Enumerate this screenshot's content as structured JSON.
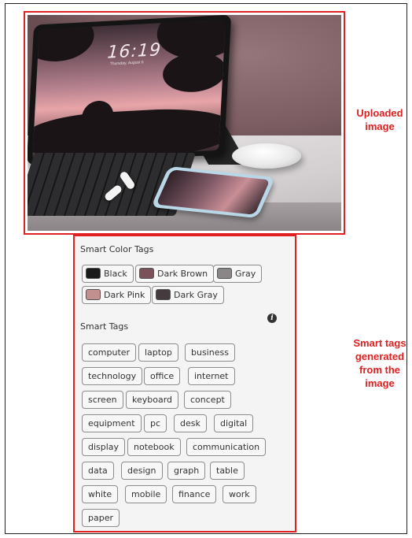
{
  "labels": {
    "uploaded": "Uploaded image",
    "smart_tags_generated": "Smart tags generated from the image"
  },
  "photo": {
    "clock": "16:19",
    "date": "Thursday, August 6"
  },
  "color_tags": {
    "title": "Smart Color Tags",
    "items": [
      {
        "label": "Black",
        "color": "#1a1a1a"
      },
      {
        "label": "Dark Brown",
        "color": "#7a5158"
      },
      {
        "label": "Gray",
        "color": "#8a8687"
      },
      {
        "label": "Dark Pink",
        "color": "#c2918f"
      },
      {
        "label": "Dark Gray",
        "color": "#433b3d"
      }
    ]
  },
  "smart_tags": {
    "title": "Smart Tags",
    "info_icon": "info-icon",
    "items": [
      "computer",
      "laptop",
      "business",
      "technology",
      "office",
      "internet",
      "screen",
      "keyboard",
      "concept",
      "equipment",
      "pc",
      "desk",
      "digital",
      "display",
      "notebook",
      "communication",
      "data",
      "design",
      "graph",
      "table",
      "white",
      "mobile",
      "finance",
      "work",
      "paper"
    ]
  },
  "colors": {
    "highlight_border": "#e02020",
    "label_text": "#e02020"
  }
}
